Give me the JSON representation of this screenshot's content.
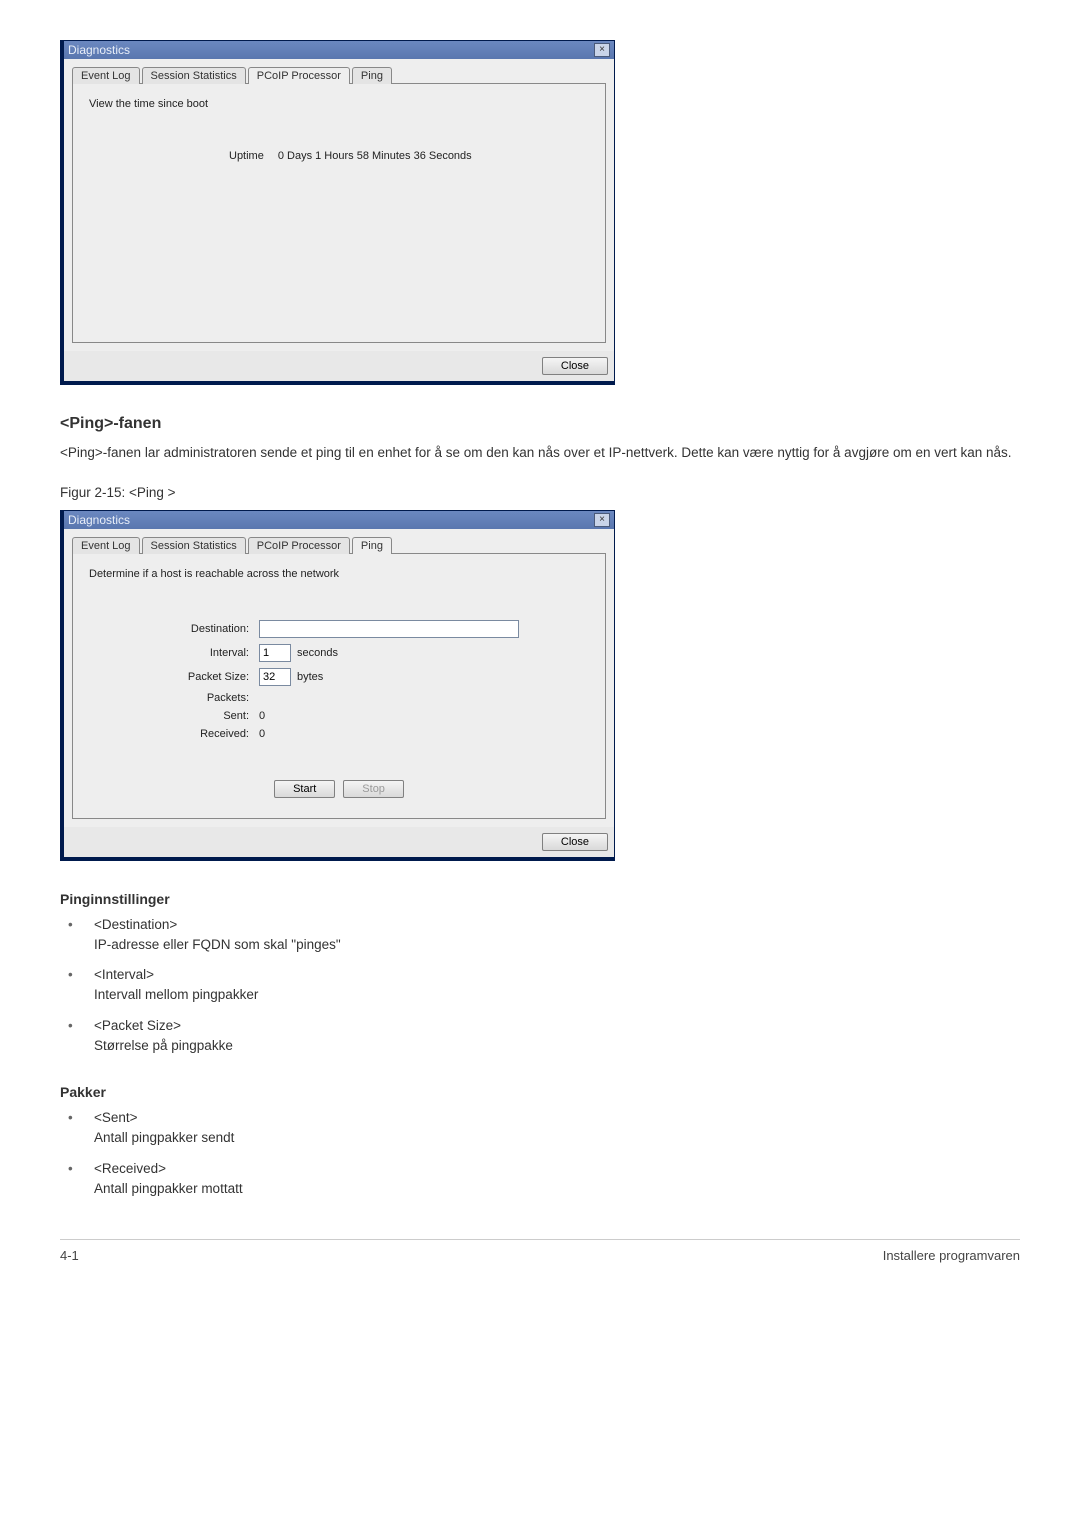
{
  "dialog1": {
    "title": "Diagnostics",
    "tabs": [
      "Event Log",
      "Session Statistics",
      "PCoIP Processor",
      "Ping"
    ],
    "active_tab_index": 2,
    "panel_text": "View the time since boot",
    "uptime_label": "Uptime",
    "uptime_value": "0 Days 1 Hours 58 Minutes 36 Seconds",
    "close_label": "Close"
  },
  "section_ping": {
    "heading": "<Ping>-fanen",
    "body": "<Ping>-fanen lar administratoren sende et ping til en enhet for å se om den kan nås over et IP-nettverk. Dette kan være nyttig for å avgjøre om en vert kan nås.",
    "figure_label": "Figur 2-15: <Ping >"
  },
  "dialog2": {
    "title": "Diagnostics",
    "tabs": [
      "Event Log",
      "Session Statistics",
      "PCoIP Processor",
      "Ping"
    ],
    "active_tab_index": 3,
    "panel_text": "Determine if a host is reachable across the network",
    "fields": {
      "destination_label": "Destination:",
      "destination_value": "",
      "interval_label": "Interval:",
      "interval_value": "1",
      "interval_unit": "seconds",
      "packet_size_label": "Packet Size:",
      "packet_size_value": "32",
      "packet_size_unit": "bytes",
      "packets_label": "Packets:",
      "sent_label": "Sent:",
      "sent_value": "0",
      "received_label": "Received:",
      "received_value": "0"
    },
    "start_label": "Start",
    "stop_label": "Stop",
    "close_label": "Close"
  },
  "ping_settings": {
    "heading": "Pinginnstillinger",
    "items": [
      {
        "term": "<Destination>",
        "desc": "IP-adresse eller FQDN som skal \"pinges\""
      },
      {
        "term": "<Interval>",
        "desc": "Intervall mellom pingpakker"
      },
      {
        "term": "<Packet Size>",
        "desc": "Størrelse på pingpakke"
      }
    ]
  },
  "packets": {
    "heading": "Pakker",
    "items": [
      {
        "term": "<Sent>",
        "desc": "Antall pingpakker sendt"
      },
      {
        "term": "<Received>",
        "desc": "Antall pingpakker mottatt"
      }
    ]
  },
  "footer": {
    "left": "4-1",
    "right": "Installere programvaren"
  }
}
